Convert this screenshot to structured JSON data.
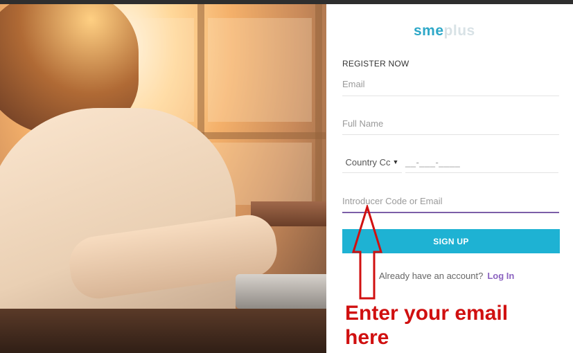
{
  "logo": {
    "part1": "sme",
    "part2": "plus"
  },
  "form": {
    "title": "REGISTER NOW",
    "email_placeholder": "Email",
    "fullname_placeholder": "Full Name",
    "country_code": "Country Cc",
    "phone_mask": "__-___-____",
    "introducer_placeholder": "Introducer Code or Email",
    "signup_label": "SIGN UP",
    "already_text": "Already have an account?",
    "login_label": "Log In"
  },
  "annotation": {
    "line1": "Enter your email",
    "line2": "here"
  },
  "colors": {
    "accent": "#1eb2d3",
    "focus_underline": "#7b5ea7",
    "annotation_red": "#d01010"
  }
}
